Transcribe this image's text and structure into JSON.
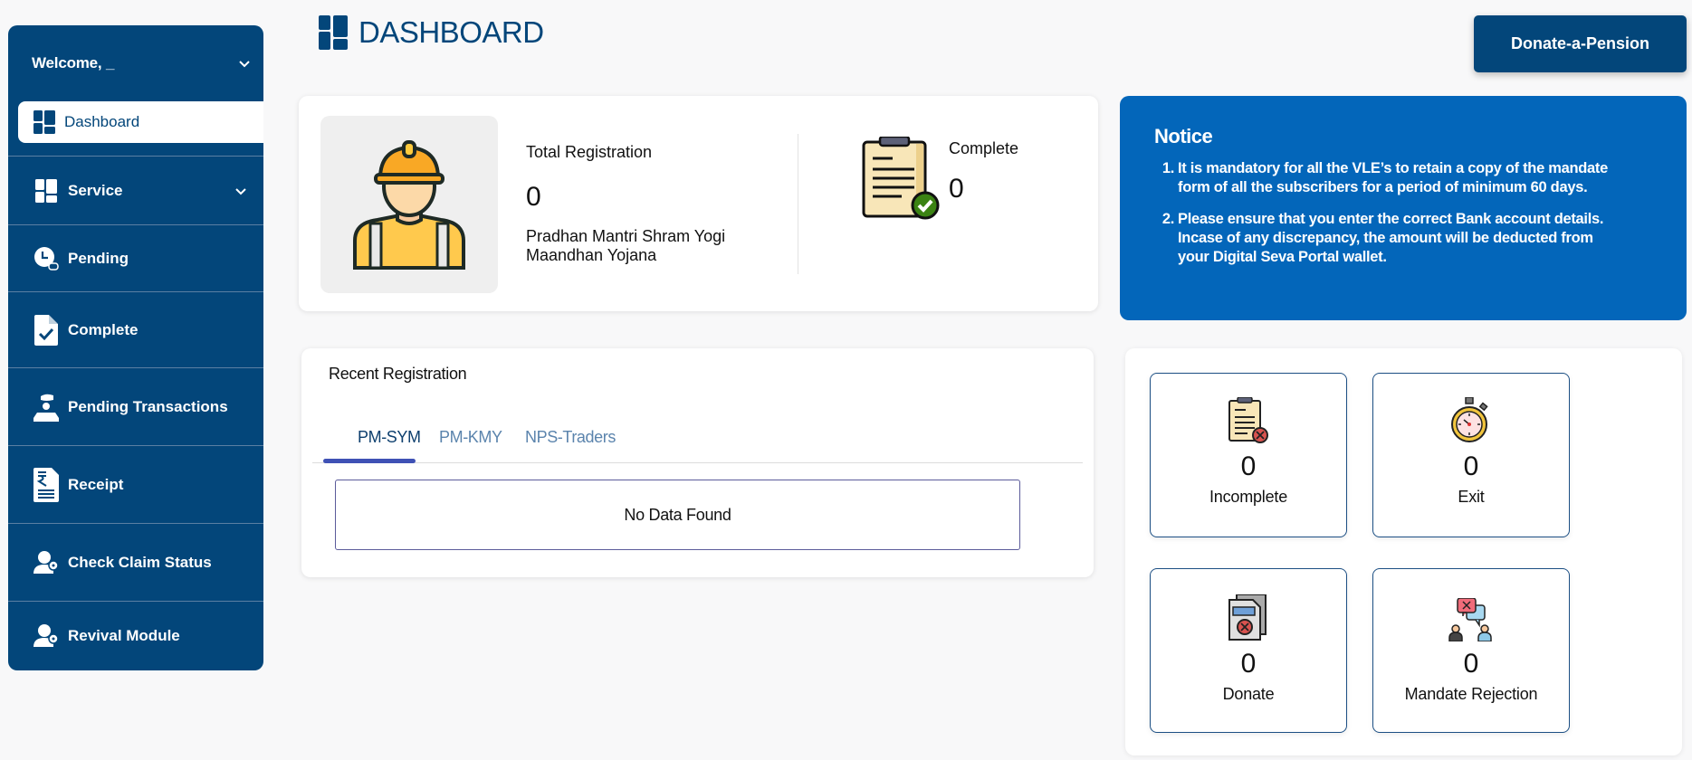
{
  "sidebar": {
    "welcome": "Welcome, _",
    "active_item": "Dashboard",
    "items": [
      {
        "label": "Service",
        "icon": "grid-icon",
        "has_submenu": true
      },
      {
        "label": "Pending",
        "icon": "clock-icon",
        "has_submenu": false
      },
      {
        "label": "Complete",
        "icon": "document-check-icon",
        "has_submenu": false
      },
      {
        "label": "Pending Transactions",
        "icon": "hand-coin-icon",
        "has_submenu": false
      },
      {
        "label": "Receipt",
        "icon": "rupee-receipt-icon",
        "has_submenu": false
      },
      {
        "label": "Check Claim Status",
        "icon": "user-key-icon",
        "has_submenu": false
      },
      {
        "label": "Revival Module",
        "icon": "user-key-icon",
        "has_submenu": false
      }
    ]
  },
  "header": {
    "title": "DASHBOARD",
    "donate_button": "Donate-a-Pension"
  },
  "summary": {
    "total_label": "Total Registration",
    "total_value": "0",
    "scheme_name": "Pradhan Mantri Shram Yogi Maandhan Yojana",
    "complete_label": "Complete",
    "complete_value": "0"
  },
  "notice": {
    "title": "Notice",
    "items": [
      "It is mandatory for all the VLE’s to retain a copy of the mandate form of all the subscribers for a period of minimum 60 days.",
      "Please ensure that you enter the correct Bank account details. Incase of any discrepancy, the amount will be deducted from your Digital Seva Portal wallet."
    ]
  },
  "recent": {
    "title": "Recent Registration",
    "tabs": [
      "PM-SYM",
      "PM-KMY",
      "NPS-Traders"
    ],
    "active_tab": "PM-SYM",
    "empty_message": "No Data Found"
  },
  "stats": [
    {
      "label": "Incomplete",
      "value": "0",
      "icon": "clipboard-x-icon"
    },
    {
      "label": "Exit",
      "value": "0",
      "icon": "stopwatch-icon"
    },
    {
      "label": "Donate",
      "value": "0",
      "icon": "document-x-icon"
    },
    {
      "label": "Mandate Rejection",
      "value": "0",
      "icon": "chat-reject-icon"
    }
  ],
  "colors": {
    "primary": "#03467a",
    "notice_bg": "#0366ba",
    "tab_indicator": "#3f51b5",
    "background": "#f8f8f9"
  }
}
